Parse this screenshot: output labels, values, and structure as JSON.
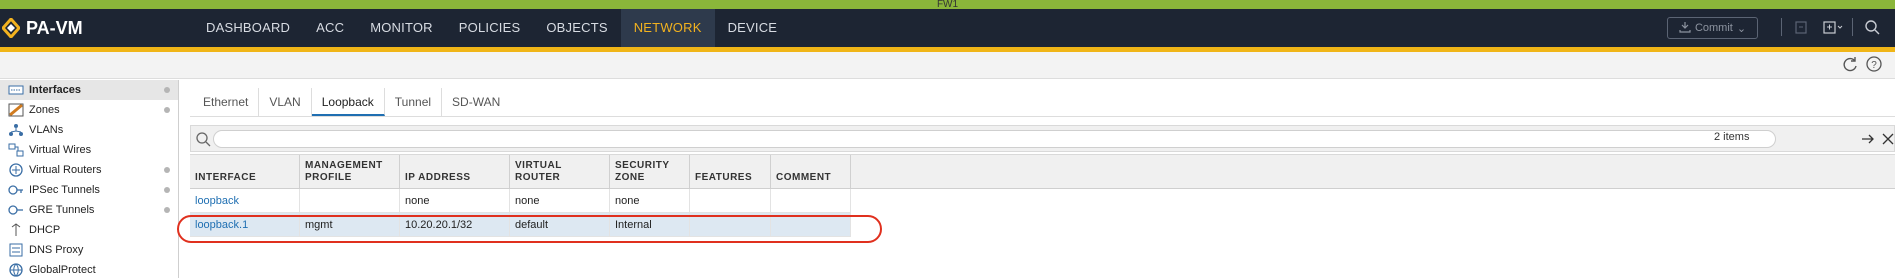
{
  "window": {
    "title": "FW1"
  },
  "header": {
    "logo_text": "PA-VM",
    "tabs": [
      {
        "label": "DASHBOARD"
      },
      {
        "label": "ACC"
      },
      {
        "label": "MONITOR"
      },
      {
        "label": "POLICIES"
      },
      {
        "label": "OBJECTS"
      },
      {
        "label": "NETWORK",
        "active": true
      },
      {
        "label": "DEVICE"
      }
    ],
    "commit_label": "Commit",
    "icons": [
      "lock-icon",
      "config-icon",
      "save-icon",
      "search-icon"
    ]
  },
  "subbar": {
    "icons": [
      "refresh-icon",
      "help-icon"
    ]
  },
  "sidebar": {
    "items": [
      {
        "label": "Interfaces",
        "icon": "interfaces-icon",
        "active": true,
        "dot": true
      },
      {
        "label": "Zones",
        "icon": "zones-icon",
        "dot": true
      },
      {
        "label": "VLANs",
        "icon": "vlans-icon"
      },
      {
        "label": "Virtual Wires",
        "icon": "virtual-wires-icon"
      },
      {
        "label": "Virtual Routers",
        "icon": "virtual-routers-icon",
        "dot": true
      },
      {
        "label": "IPSec Tunnels",
        "icon": "ipsec-icon",
        "dot": true
      },
      {
        "label": "GRE Tunnels",
        "icon": "gre-icon",
        "dot": true
      },
      {
        "label": "DHCP",
        "icon": "dhcp-icon"
      },
      {
        "label": "DNS Proxy",
        "icon": "dns-icon"
      },
      {
        "label": "GlobalProtect",
        "icon": "globalprotect-icon"
      }
    ]
  },
  "main": {
    "tabs": [
      {
        "label": "Ethernet"
      },
      {
        "label": "VLAN"
      },
      {
        "label": "Loopback",
        "active": true
      },
      {
        "label": "Tunnel"
      },
      {
        "label": "SD-WAN"
      }
    ],
    "search": {
      "placeholder": "",
      "count": "2 items"
    },
    "table": {
      "columns": [
        "INTERFACE",
        "MANAGEMENT PROFILE",
        "IP ADDRESS",
        "VIRTUAL ROUTER",
        "SECURITY ZONE",
        "FEATURES",
        "COMMENT"
      ],
      "rows": [
        {
          "interface": "loopback",
          "management_profile": "",
          "ip_address": "none",
          "virtual_router": "none",
          "security_zone": "none",
          "features": "",
          "comment": ""
        },
        {
          "interface": "loopback.1",
          "management_profile": "mgmt",
          "ip_address": "10.20.20.1/32",
          "virtual_router": "default",
          "security_zone": "Internal",
          "features": "",
          "comment": "",
          "selected": true
        }
      ]
    }
  },
  "colors": {
    "accent": "#f2b21f",
    "navbar": "#1d2533",
    "topstrip": "#8ab63a",
    "highlight": "#e0301e",
    "link": "#1f6fb2"
  }
}
